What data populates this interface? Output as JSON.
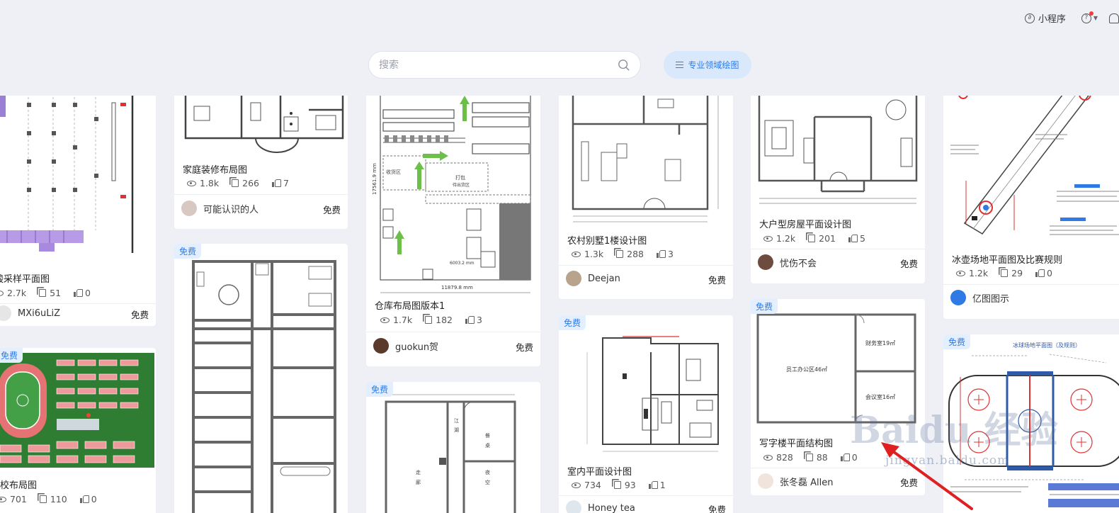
{
  "header": {
    "mini_program": "小程序",
    "help_icon": "question-circle-icon",
    "notification_icon": "bell-icon"
  },
  "search": {
    "placeholder": "搜索",
    "value": ""
  },
  "domain_button": {
    "label": "专业领域绘图"
  },
  "free_badge": "免费",
  "cards": [
    {
      "title": "酸采样平面图",
      "views": "2.7k",
      "copies": "51",
      "likes": "0",
      "author": "MXi6uLiZ",
      "price": "免费"
    },
    {
      "title": "家庭装修布局图",
      "views": "1.8k",
      "copies": "266",
      "likes": "7",
      "author": "可能认识的人",
      "price": "免费"
    },
    {
      "title": "仓库布局图版本1",
      "views": "1.7k",
      "copies": "182",
      "likes": "3",
      "author": "guokun贺",
      "price": "免费"
    },
    {
      "title": "农村别墅1楼设计图",
      "views": "1.3k",
      "copies": "288",
      "likes": "3",
      "author": "Deejan",
      "price": "免费"
    },
    {
      "title": "大户型房屋平面设计图",
      "views": "1.2k",
      "copies": "201",
      "likes": "5",
      "author": "忧伤不会",
      "price": "免费"
    },
    {
      "title": "冰壶场地平面图及比赛规则",
      "views": "1.2k",
      "copies": "29",
      "likes": "0",
      "author": "亿图图示",
      "price": "免费"
    },
    {
      "title": "校布局图",
      "views": "701",
      "copies": "110",
      "likes": "0"
    },
    {
      "title": "室内平面设计图",
      "views": "734",
      "copies": "93",
      "likes": "1",
      "author": "Honey tea",
      "price": "免费"
    },
    {
      "title": "写字楼平面结构图",
      "views": "828",
      "copies": "88",
      "likes": "0",
      "author": "张冬磊 Allen",
      "price": "免费"
    }
  ],
  "thumb_text": {
    "warehouse_zone": "收货区",
    "warehouse_pack": "打包",
    "warehouse_ship": "待出货区",
    "warehouse_width": "11879.8 mm",
    "warehouse_height": "17561.9 mm",
    "warehouse_inner": "6003.2 mm",
    "office_main": "员工办公区46㎡",
    "office_finance": "财务室19㎡",
    "office_meeting": "会议室16㎡",
    "hockey_title": "冰球场地平面图（及规则）"
  },
  "watermark": {
    "brand": "Baidu 经验",
    "url": "jingyan.baidu.com"
  },
  "colors": {
    "accent": "#2f7ae5",
    "badge_bg": "#e3efff",
    "page_bg": "#eef0f6"
  }
}
